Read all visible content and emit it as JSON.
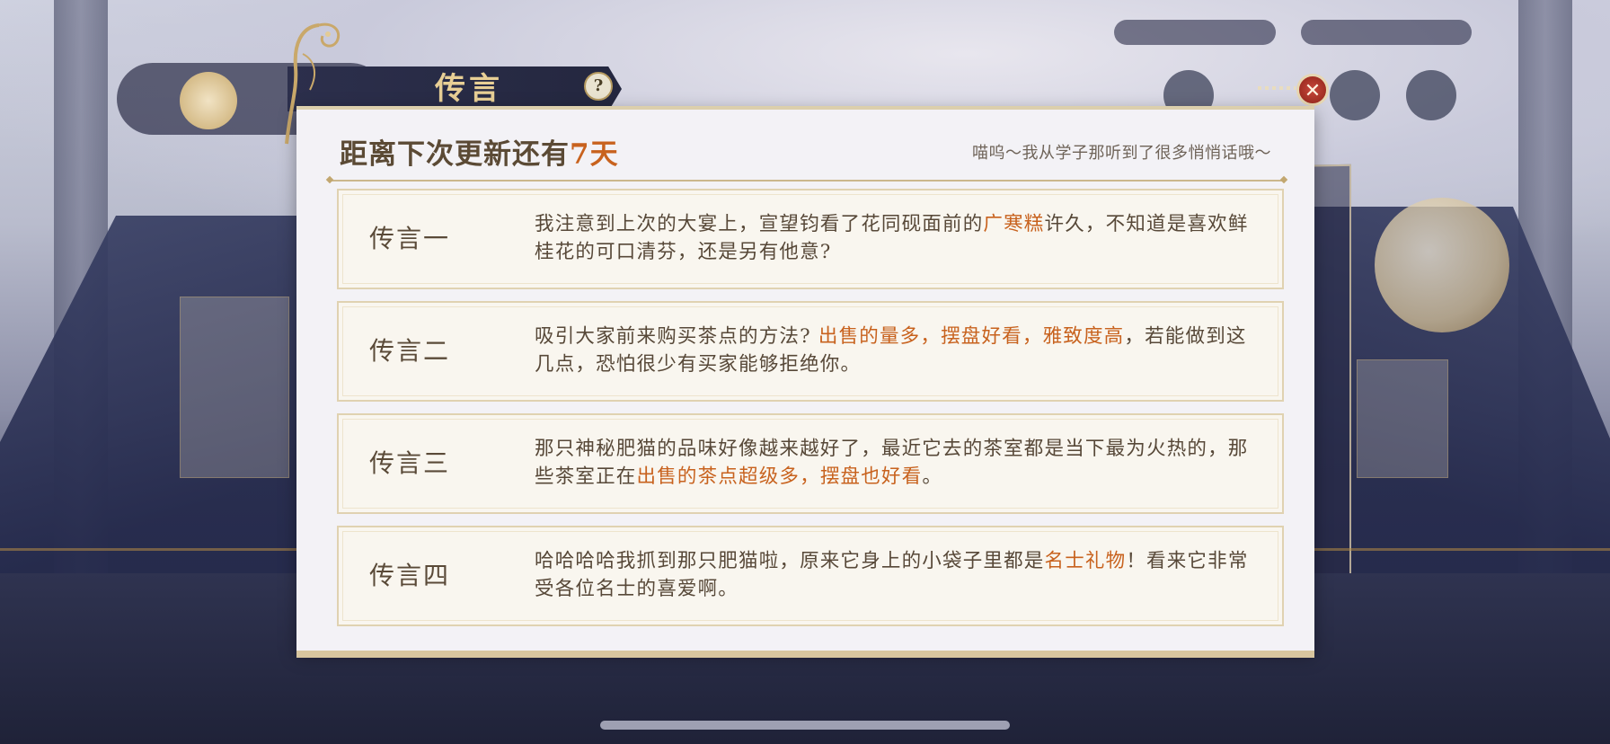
{
  "title": "传言",
  "help_label": "?",
  "close_label": "✕",
  "header": {
    "prefix": "距离下次更新还有",
    "days": "7天",
    "note": "喵呜～我从学子那听到了很多悄悄话哦～"
  },
  "rumors": [
    {
      "label": "传言一",
      "parts": [
        {
          "text": "我注意到上次的大宴上，宣望钧看了花同砚面前的",
          "hl": false
        },
        {
          "text": "广寒糕",
          "hl": true
        },
        {
          "text": "许久，不知道是喜欢鲜桂花的可口清芬，还是另有他意?",
          "hl": false
        }
      ]
    },
    {
      "label": "传言二",
      "parts": [
        {
          "text": "吸引大家前来购买茶点的方法? ",
          "hl": false
        },
        {
          "text": "出售的量多，摆盘好看，雅致度高",
          "hl": true
        },
        {
          "text": "，若能做到这几点，恐怕很少有买家能够拒绝你。",
          "hl": false
        }
      ]
    },
    {
      "label": "传言三",
      "parts": [
        {
          "text": "那只神秘肥猫的品味好像越来越好了，最近它去的茶室都是当下最为火热的，那些茶室正在",
          "hl": false
        },
        {
          "text": "出售的茶点超级多，摆盘也好看",
          "hl": true
        },
        {
          "text": "。",
          "hl": false
        }
      ]
    },
    {
      "label": "传言四",
      "parts": [
        {
          "text": "哈哈哈哈我抓到那只肥猫啦，原来它身上的小袋子里都是",
          "hl": false
        },
        {
          "text": "名士礼物",
          "hl": true
        },
        {
          "text": "！看来它非常受各位名士的喜爱啊。",
          "hl": false
        }
      ]
    }
  ],
  "colors": {
    "highlight": "#c8621e",
    "text": "#574838",
    "banner": "#2c2f4c",
    "gold": "#e8cf95",
    "close": "#b5362a"
  }
}
